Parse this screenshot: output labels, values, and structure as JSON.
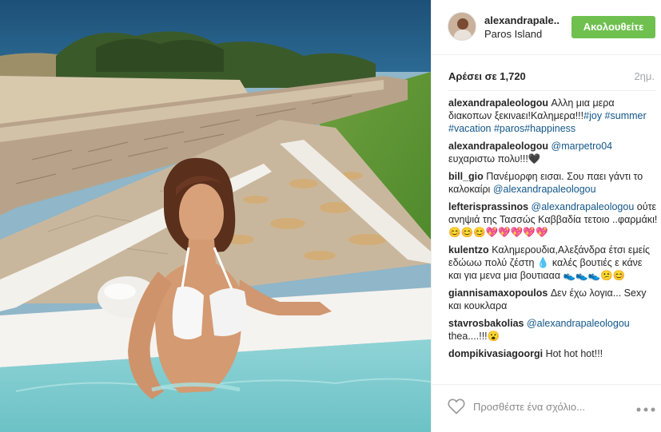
{
  "post": {
    "username": "alexandrapale..",
    "location": "Paros Island",
    "follow_label": "Ακολουθείτε",
    "likes": "Αρέσει σε 1,720",
    "time": "2ημ."
  },
  "comments": [
    {
      "user": "alexandrapaleologou",
      "text": "Αλλη μια μερα διακοπων ξεκινaει!Καλημερα!!!",
      "link": "#joy #summer #vacation #paros#happiness"
    },
    {
      "user": "alexandrapaleologou",
      "link": "@marpetro04",
      "text": "ευχαριστω πολυ!!!🖤"
    },
    {
      "user": "bill_gio",
      "text": "Πανέμορφη εισαι. Σου παει γάντι το καλοκαίρι",
      "link": "@alexandrapaleologou"
    },
    {
      "user": "lefterisprassinos",
      "link": "@alexandrapaleologou",
      "text": "ούτε ανηψιά της Τασσώς Καββαδία τετοιο ..φαρμάκι! 😊😊😊💖💖💖💖💖"
    },
    {
      "user": "kulentzo",
      "text": "Καλημερουδια,Αλεξάνδρα έτσι εμείς εδώωω πολύ ζέστη 💧 καλές βουτιές ε κάνε και για μενα μια βουτιααα 👟👟👟😕😊"
    },
    {
      "user": "giannisamaxopoulos",
      "text": "Δεν έχω λογια... Sexy και κουκλαρα"
    },
    {
      "user": "stavrosbakolias",
      "link": "@alexandrapaleologou",
      "text": "thea....!!!😮"
    },
    {
      "user": "dompikivasiagoorgi",
      "text": "Hot hot hot!!!"
    }
  ],
  "footer": {
    "comment_placeholder": "Προσθέστε ένα σχόλιο...",
    "heart_icon": "heart-outline-icon",
    "more_icon": "more-options-icon"
  },
  "colors": {
    "follow": "#70c050",
    "link": "#125688",
    "muted": "#a5a7aa"
  }
}
